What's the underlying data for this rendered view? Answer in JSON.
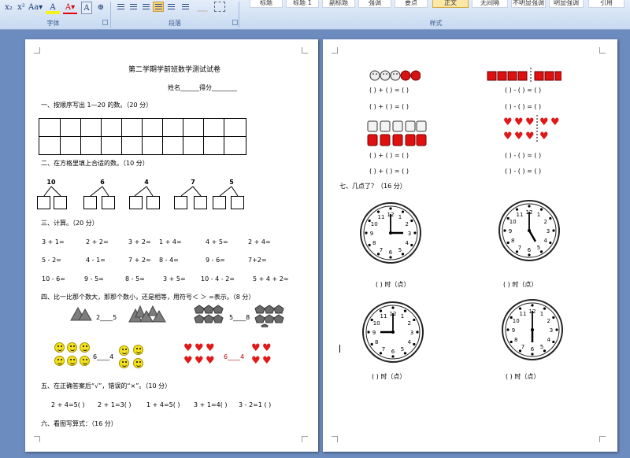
{
  "ribbon": {
    "font_group_label": "字体",
    "paragraph_group_label": "段落",
    "styles_group_label": "样式",
    "font_buttons": [
      "x₂",
      "x²",
      "Aa▾",
      "A",
      "A▾",
      "A",
      "⊕"
    ],
    "styles": [
      "标题",
      "标题 1",
      "副标题",
      "强调",
      "要点",
      "正文",
      "无间隔",
      "不明显强调",
      "明显强调",
      "引用"
    ],
    "selected_style": "正文"
  },
  "page1": {
    "title": "第二学期学前班数学测试试卷",
    "name_line": "姓名______得分________",
    "q1": "一、按顺序写出 1—20 的数。（20 分）",
    "q2": "二、在方格里填上合适的数。（10 分）",
    "split_numbers": [
      "10",
      "6",
      "4",
      "7",
      "5"
    ],
    "q3": "三、计算。（20 分）",
    "calc_rows": [
      [
        "3 + 1=",
        "2 + 2=",
        "3 + 2=",
        "1 + 4=",
        "4 + 5=",
        "2 + 4="
      ],
      [
        "5 - 2=",
        "4 - 1=",
        "7 + 2=",
        "8 - 4=",
        "9 - 6=",
        "7+2="
      ],
      [
        "10 - 6=",
        "9 - 5=",
        "8 - 5=",
        "3 + 5=",
        "10 - 4 - 2=",
        "5 + 4 + 2="
      ]
    ],
    "q4": "四、比一比那个数大，那那个数小，还是相等，用符号＜ ＞ =表示。（8 分）",
    "compare_labels": [
      "2____5",
      "5____8",
      "6____4",
      "6____4"
    ],
    "q5": "五、在正确答案后“√”，错误的“×”。（10 分）",
    "judge_items": [
      "2 + 4=5(   )",
      "2 + 1=3(   )",
      "1 + 4=5(   )",
      "3 + 1=4(   )",
      "3 - 2=1 (  )"
    ],
    "q6": "六、看图写算式：（16 分）"
  },
  "page2": {
    "add_line": "(    ) + (    ) = (    )",
    "sub_line": "(    ) - (    ) = (    )",
    "q7": "七、几点了？（16 分）",
    "clock_label": "(          ) 时（点）",
    "clock_hours": [
      3,
      5,
      9,
      6
    ]
  },
  "colors": {
    "accent_red": "#e01818",
    "smiley_yellow": "#f3e21c",
    "page_bg": "#ffffff",
    "workspace": "#6c8bbe"
  }
}
